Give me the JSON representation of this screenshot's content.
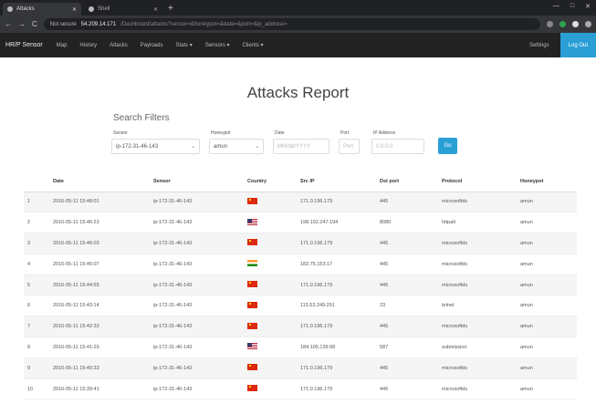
{
  "browser": {
    "tabs": [
      {
        "label": "Attacks",
        "active": true
      },
      {
        "label": "Shell",
        "active": false
      }
    ],
    "new_tab": "+",
    "window_controls": [
      "—",
      "□",
      "✕"
    ],
    "address": {
      "security": "Not secure",
      "host": "54.209.14.171",
      "path": "/Dashboard/attacks?sensor=&honeypot=&date=&port=&ip_address="
    },
    "nav_icons": [
      "←",
      "→",
      "C"
    ]
  },
  "navbar": {
    "brand": "HR/P Sensor",
    "items": [
      "Map",
      "History",
      "Attacks",
      "Payloads",
      "Stats ▾",
      "Sensors ▾",
      "Clients ▾"
    ],
    "settings": "Settings",
    "logout": "Log Out"
  },
  "page": {
    "title": "Attacks Report",
    "filters": {
      "heading": "Search Filters",
      "sensor": {
        "label": "Sensor",
        "value": "ip-172-31-46-143"
      },
      "honeypot": {
        "label": "Honeypot",
        "value": "amun"
      },
      "date": {
        "label": "Date",
        "placeholder": "MM/dd/YYYY"
      },
      "port": {
        "label": "Port",
        "placeholder": "Port"
      },
      "ip": {
        "label": "IP Address",
        "placeholder": "0.0.0.0"
      },
      "button": "Go"
    }
  },
  "table": {
    "columns": [
      "",
      "Date",
      "Sensor",
      "Country",
      "Src IP",
      "Dst port",
      "Protocol",
      "Honeypot"
    ],
    "rows": [
      {
        "n": "1",
        "date": "2016-05-11 15:48:01",
        "sensor": "ip-172-31-46-143",
        "flag": "cn",
        "ip": "171.0.196.179",
        "port": "445",
        "protocol": "microsoftds",
        "honeypot": "amun"
      },
      {
        "n": "2",
        "date": "2016-05-11 15:46:23",
        "sensor": "ip-172-31-46-143",
        "flag": "us",
        "ip": "198.102.247.194",
        "port": "8080",
        "protocol": "httpalt",
        "honeypot": "amun"
      },
      {
        "n": "3",
        "date": "2016-05-11 15:46:03",
        "sensor": "ip-172-31-46-143",
        "flag": "cn",
        "ip": "171.0.196.179",
        "port": "445",
        "protocol": "microsoftds",
        "honeypot": "amun"
      },
      {
        "n": "4",
        "date": "2016-05-11 15:45:07",
        "sensor": "ip-172-31-46-143",
        "flag": "in",
        "ip": "182.75.153.17",
        "port": "445",
        "protocol": "microsoftds",
        "honeypot": "amun"
      },
      {
        "n": "5",
        "date": "2016-05-11 15:44:55",
        "sensor": "ip-172-31-46-143",
        "flag": "cn",
        "ip": "171.0.196.179",
        "port": "445",
        "protocol": "microsoftds",
        "honeypot": "amun"
      },
      {
        "n": "6",
        "date": "2016-05-11 15:43:14",
        "sensor": "ip-172-31-46-143",
        "flag": "cn",
        "ip": "115.53.249.251",
        "port": "23",
        "protocol": "telnet",
        "honeypot": "amun"
      },
      {
        "n": "7",
        "date": "2016-05-11 15:42:33",
        "sensor": "ip-172-31-46-143",
        "flag": "cn",
        "ip": "171.0.196.179",
        "port": "445",
        "protocol": "microsoftds",
        "honeypot": "amun"
      },
      {
        "n": "8",
        "date": "2016-05-11 15:41:29",
        "sensor": "ip-172-31-46-143",
        "flag": "us",
        "ip": "184.105.139.68",
        "port": "587",
        "protocol": "submission",
        "honeypot": "amun"
      },
      {
        "n": "9",
        "date": "2016-05-11 15:40:33",
        "sensor": "ip-172-31-46-143",
        "flag": "cn",
        "ip": "171.0.196.179",
        "port": "445",
        "protocol": "microsoftds",
        "honeypot": "amun"
      },
      {
        "n": "10",
        "date": "2016-05-11 15:39:41",
        "sensor": "ip-172-31-46-143",
        "flag": "cn",
        "ip": "171.0.196.179",
        "port": "445",
        "protocol": "microsoftds",
        "honeypot": "amun"
      }
    ]
  },
  "colors": {
    "accent": "#2a9fd6",
    "navbar": "#222222",
    "chrome": "#202124"
  }
}
